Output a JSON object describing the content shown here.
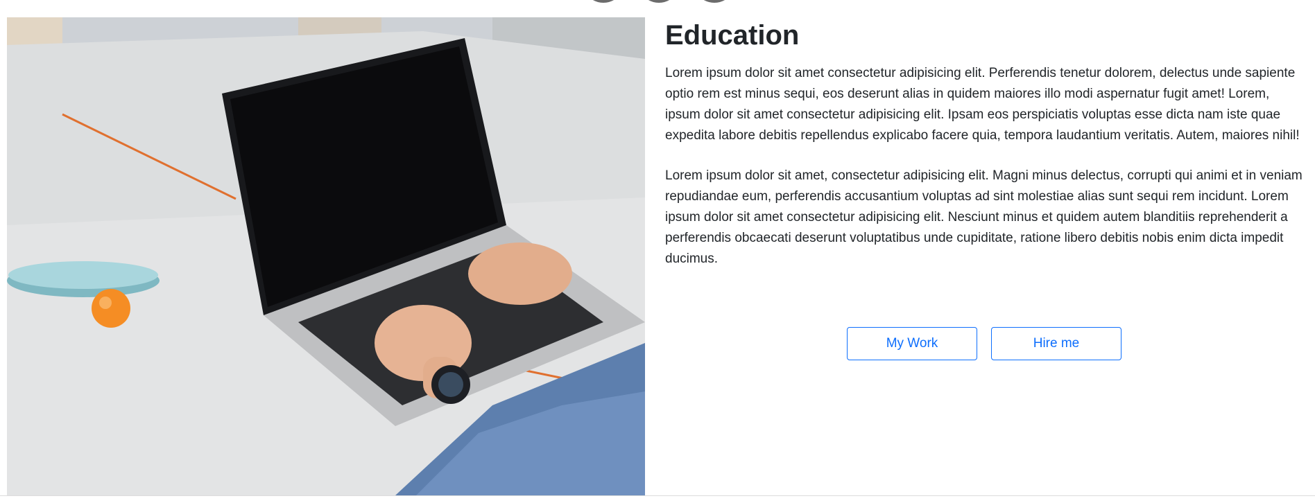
{
  "section": {
    "title": "Education",
    "paragraphs": [
      "Lorem ipsum dolor sit amet consectetur adipisicing elit. Perferendis tenetur dolorem, delectus unde sapiente optio rem est minus sequi, eos deserunt alias in quidem maiores illo modi aspernatur fugit amet! Lorem, ipsum dolor sit amet consectetur adipisicing elit. Ipsam eos perspiciatis voluptas esse dicta nam iste quae expedita labore debitis repellendus explicabo facere quia, tempora laudantium veritatis. Autem, maiores nihil!",
      "Lorem ipsum dolor sit amet, consectetur adipisicing elit. Magni minus delectus, corrupti qui animi et in veniam repudiandae eum, perferendis accusantium voluptas ad sint molestiae alias sunt sequi rem incidunt. Lorem ipsum dolor sit amet consectetur adipisicing elit. Nesciunt minus et quidem autem blanditiis reprehenderit a perferendis obcaecati deserunt voluptatibus unde cupiditate, ratione libero debitis nobis enim dicta impedit ducimus."
    ]
  },
  "buttons": {
    "my_work": "My Work",
    "hire_me": "Hire me"
  },
  "image": {
    "subject": "laptop-typing-photo"
  },
  "colors": {
    "accent": "#0d6efd",
    "text": "#212529"
  }
}
